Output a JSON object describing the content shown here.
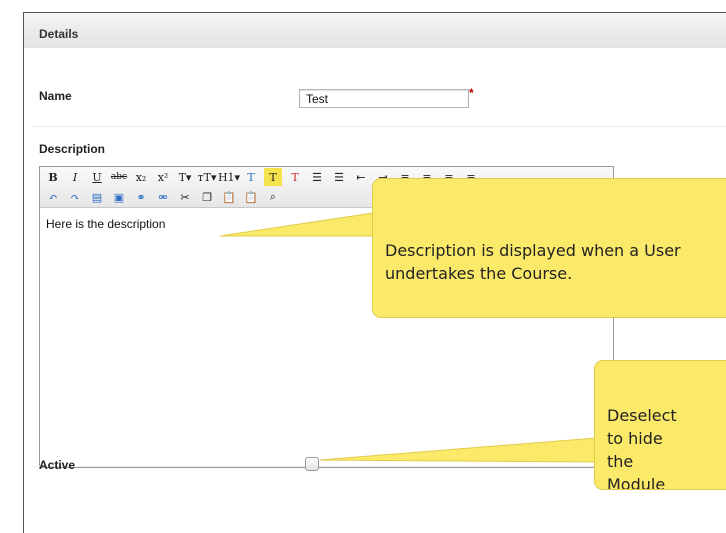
{
  "panel": {
    "title": "Details"
  },
  "form": {
    "name_label": "Name",
    "name_value": "Test",
    "required_mark": "*",
    "description_label": "Description",
    "description_text": "Here is the description",
    "active_label": "Active",
    "active_checked": false
  },
  "toolbar": {
    "row1": [
      {
        "icon": "bold-icon",
        "glyph": "B"
      },
      {
        "icon": "italic-icon",
        "glyph": "I"
      },
      {
        "icon": "underline-icon",
        "glyph": "U"
      },
      {
        "icon": "strikethrough-icon",
        "glyph": "abc"
      },
      {
        "icon": "subscript-icon",
        "glyph": "x₂"
      },
      {
        "icon": "superscript-icon",
        "glyph": "x²"
      },
      {
        "icon": "font-family-icon",
        "glyph": "T▾"
      },
      {
        "icon": "font-size-icon",
        "glyph": "тT▾"
      },
      {
        "icon": "heading-icon",
        "glyph": "H1▾"
      },
      {
        "icon": "text-color-icon",
        "glyph": "T"
      },
      {
        "icon": "highlight-icon",
        "glyph": "T"
      },
      {
        "icon": "clear-format-icon",
        "glyph": "T"
      },
      {
        "icon": "bullet-list-icon",
        "glyph": "☰"
      },
      {
        "icon": "numbered-list-icon",
        "glyph": "☰"
      },
      {
        "icon": "outdent-icon",
        "glyph": "⇤"
      },
      {
        "icon": "indent-icon",
        "glyph": "⇥"
      },
      {
        "icon": "align-left-icon",
        "glyph": "≡"
      },
      {
        "icon": "align-center-icon",
        "glyph": "≡"
      },
      {
        "icon": "align-right-icon",
        "glyph": "≡"
      },
      {
        "icon": "align-justify-icon",
        "glyph": "≡"
      }
    ],
    "row2": [
      {
        "icon": "undo-icon",
        "glyph": "↶"
      },
      {
        "icon": "redo-icon",
        "glyph": "↷"
      },
      {
        "icon": "horizontal-rule-icon",
        "glyph": "▤"
      },
      {
        "icon": "image-icon",
        "glyph": "▣"
      },
      {
        "icon": "link-icon",
        "glyph": "⚭"
      },
      {
        "icon": "unlink-icon",
        "glyph": "⚮"
      },
      {
        "icon": "cut-icon",
        "glyph": "✂"
      },
      {
        "icon": "copy-icon",
        "glyph": "❐"
      },
      {
        "icon": "paste-icon",
        "glyph": "📋"
      },
      {
        "icon": "paste-text-icon",
        "glyph": "📋"
      },
      {
        "icon": "find-icon",
        "glyph": "⌕"
      }
    ]
  },
  "callouts": {
    "description": "Description is displayed when a User undertakes the Course.",
    "active": "Deselect to hide the Module from Users."
  },
  "colors": {
    "callout_fill": "#fbe96a",
    "required": "#bb0000",
    "toolbar_accent": "#2b6cc4"
  }
}
